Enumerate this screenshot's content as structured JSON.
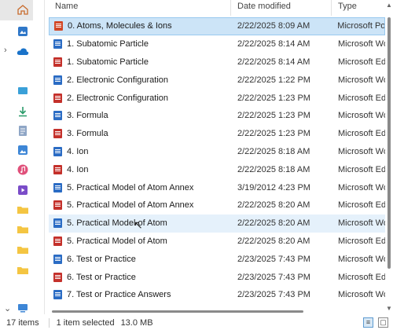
{
  "columns": {
    "name": "Name",
    "date": "Date modified",
    "type": "Type"
  },
  "files": [
    {
      "name": "0. Atoms, Molecules & Ions",
      "date": "2/22/2025 8:09 AM",
      "type": "Microsoft PowerPoint",
      "icon": "ppt"
    },
    {
      "name": "1. Subatomic Particle",
      "date": "2/22/2025 8:14 AM",
      "type": "Microsoft Word",
      "icon": "word"
    },
    {
      "name": "1. Subatomic Particle",
      "date": "2/22/2025 8:14 AM",
      "type": "Microsoft Edge",
      "icon": "pdf"
    },
    {
      "name": "2. Electronic Configuration",
      "date": "2/22/2025 1:22 PM",
      "type": "Microsoft Word",
      "icon": "word"
    },
    {
      "name": "2. Electronic Configuration",
      "date": "2/22/2025 1:23 PM",
      "type": "Microsoft Edge",
      "icon": "pdf"
    },
    {
      "name": "3. Formula",
      "date": "2/22/2025 1:23 PM",
      "type": "Microsoft Word",
      "icon": "word"
    },
    {
      "name": "3. Formula",
      "date": "2/22/2025 1:23 PM",
      "type": "Microsoft Edge",
      "icon": "pdf"
    },
    {
      "name": "4. Ion",
      "date": "2/22/2025 8:18 AM",
      "type": "Microsoft Word",
      "icon": "word"
    },
    {
      "name": "4. Ion",
      "date": "2/22/2025 8:18 AM",
      "type": "Microsoft Edge",
      "icon": "pdf"
    },
    {
      "name": "5. Practical Model of Atom Annex",
      "date": "3/19/2012 4:23 PM",
      "type": "Microsoft Word",
      "icon": "word"
    },
    {
      "name": "5. Practical Model of Atom Annex",
      "date": "2/22/2025 8:20 AM",
      "type": "Microsoft Edge",
      "icon": "pdf"
    },
    {
      "name": "5. Practical Model of Atom",
      "date": "2/22/2025 8:20 AM",
      "type": "Microsoft Word",
      "icon": "word"
    },
    {
      "name": "5. Practical Model of Atom",
      "date": "2/22/2025 8:20 AM",
      "type": "Microsoft Edge",
      "icon": "pdf"
    },
    {
      "name": "6. Test or Practice",
      "date": "2/23/2025 7:43 PM",
      "type": "Microsoft Word",
      "icon": "word"
    },
    {
      "name": "6. Test or Practice",
      "date": "2/23/2025 7:43 PM",
      "type": "Microsoft Edge",
      "icon": "pdf"
    },
    {
      "name": "7. Test or Practice Answers",
      "date": "2/23/2025 7:43 PM",
      "type": "Microsoft Word",
      "icon": "word"
    }
  ],
  "selected_index": 0,
  "hover_index": 11,
  "status": {
    "items": "17 items",
    "selected": "1 item selected",
    "size": "13.0 MB"
  },
  "nav_icons": [
    "home-icon",
    "gallery-icon",
    "onedrive-icon",
    "desktop-icon",
    "downloads-icon",
    "documents-icon",
    "pictures-icon",
    "music-icon",
    "videos-icon",
    "folder-icon",
    "folder-icon",
    "folder-icon",
    "folder-icon",
    "this-pc-icon"
  ],
  "colors": {
    "selected_bg": "#cce4f7",
    "hover_bg": "#e5f1fb",
    "word": "#2b6cc4",
    "pdf": "#c4312b",
    "ppt": "#d24726"
  }
}
